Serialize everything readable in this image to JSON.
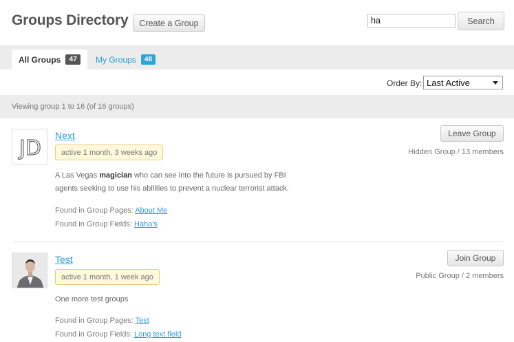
{
  "header": {
    "title": "Groups Directory",
    "create_button": "Create a Group",
    "search_value": "ha",
    "search_button": "Search"
  },
  "tabs": [
    {
      "label": "All Groups",
      "count": "47",
      "active": true
    },
    {
      "label": "My Groups",
      "count": "46",
      "active": false
    }
  ],
  "order": {
    "label": "Order By:",
    "selected": "Last Active"
  },
  "viewing": "Viewing group 1 to 16 (of 16 groups)",
  "groups": [
    {
      "name": "Next",
      "activity": "active 1 month, 3 weeks ago",
      "description_pre": "A Las Vegas ",
      "description_bold": "magician",
      "description_post": " who can see into the future is pursued by FBI agents seeking to use his abilities to prevent a nuclear terrorist attack.",
      "found_pages_label": "Found in Group Pages:",
      "found_pages_link": "About Me",
      "found_fields_label": "Found in Group Fields:",
      "found_fields_link": "Haha's",
      "button": "Leave Group",
      "meta": "Hidden Group / 13 members",
      "avatar_text": "JD"
    },
    {
      "name": "Test",
      "activity": "active 1 month, 1 week ago",
      "description": "One more test groups",
      "found_pages_label": "Found in Group Pages:",
      "found_pages_link": "Test",
      "found_fields_label": "Found in Group Fields:",
      "found_fields_link": "Long text field",
      "button": "Join Group",
      "meta": "Public Group / 2 members"
    }
  ]
}
